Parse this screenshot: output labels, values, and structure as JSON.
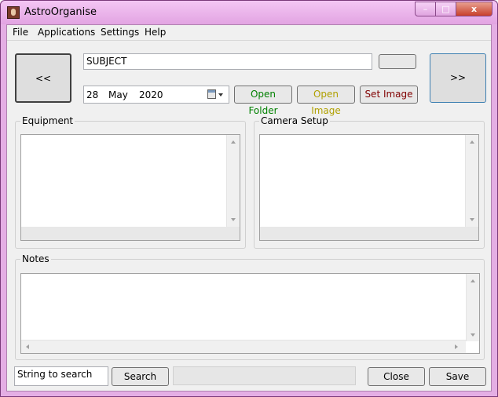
{
  "window": {
    "title": "AstroOrganise",
    "controls": {
      "minimize": "–",
      "maximize": "□",
      "close": "x"
    }
  },
  "menu": [
    "File",
    "Applications",
    "Settings",
    "Help"
  ],
  "nav": {
    "prev_label": "<<",
    "next_label": ">>"
  },
  "subject": {
    "value": "SUBJECT"
  },
  "small_button_label": "",
  "date": {
    "day": "28",
    "month": "May",
    "year": "2020",
    "icon": "calendar-icon"
  },
  "buttons": {
    "open_folder": "Open Folder",
    "open_image": "Open Image",
    "set_image": "Set Image",
    "search": "Search",
    "close": "Close",
    "save": "Save"
  },
  "colors": {
    "open_folder_text": "#008000",
    "open_image_text": "#b0a000",
    "set_image_text": "#800000",
    "window_frame": "#e4aee4"
  },
  "groups": {
    "equipment": "Equipment",
    "camera_setup": "Camera Setup",
    "notes": "Notes"
  },
  "search": {
    "value": "String to search"
  }
}
